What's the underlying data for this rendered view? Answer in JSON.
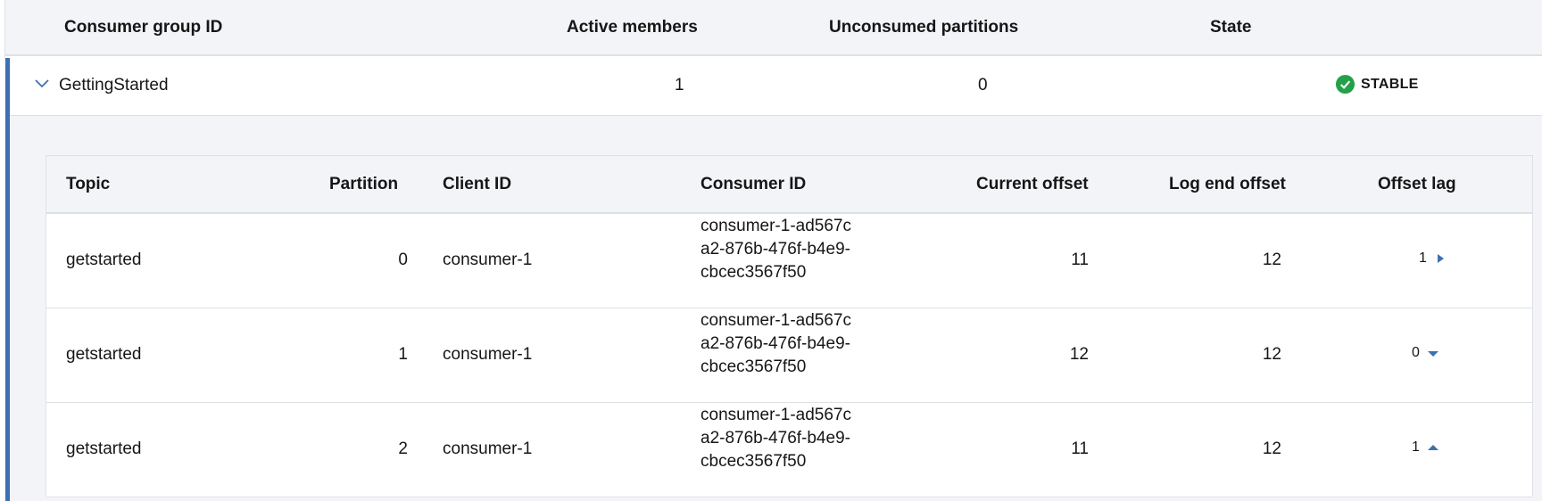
{
  "outer_table": {
    "headers": {
      "group_id": "Consumer group ID",
      "active_members": "Active members",
      "unconsumed_partitions": "Unconsumed partitions",
      "state": "State"
    },
    "group": {
      "id": "GettingStarted",
      "active_members": "1",
      "unconsumed_partitions": "0",
      "state": "STABLE",
      "state_color": "#24a148",
      "expanded": true
    }
  },
  "inner_table": {
    "headers": {
      "topic": "Topic",
      "partition": "Partition",
      "client_id": "Client ID",
      "consumer_id": "Consumer ID",
      "current_offset": "Current offset",
      "log_end_offset": "Log end offset",
      "offset_lag": "Offset lag"
    },
    "rows": [
      {
        "topic": "getstarted",
        "partition": "0",
        "client_id": "consumer-1",
        "consumer_id": "consumer-1-ad567ca2-876b-476f-b4e9-cbcec3567f50",
        "current_offset": "11",
        "log_end_offset": "12",
        "offset_lag": "1",
        "lag_icon": "caret-right-icon"
      },
      {
        "topic": "getstarted",
        "partition": "1",
        "client_id": "consumer-1",
        "consumer_id": "consumer-1-ad567ca2-876b-476f-b4e9-cbcec3567f50",
        "current_offset": "12",
        "log_end_offset": "12",
        "offset_lag": "0",
        "lag_icon": "caret-down-icon"
      },
      {
        "topic": "getstarted",
        "partition": "2",
        "client_id": "consumer-1",
        "consumer_id": "consumer-1-ad567ca2-876b-476f-b4e9-cbcec3567f50",
        "current_offset": "11",
        "log_end_offset": "12",
        "offset_lag": "1",
        "lag_icon": "caret-up-icon"
      }
    ]
  },
  "colors": {
    "accent": "#3d70b2",
    "header_bg": "#f2f4f8",
    "caret": "#3d70b2"
  }
}
